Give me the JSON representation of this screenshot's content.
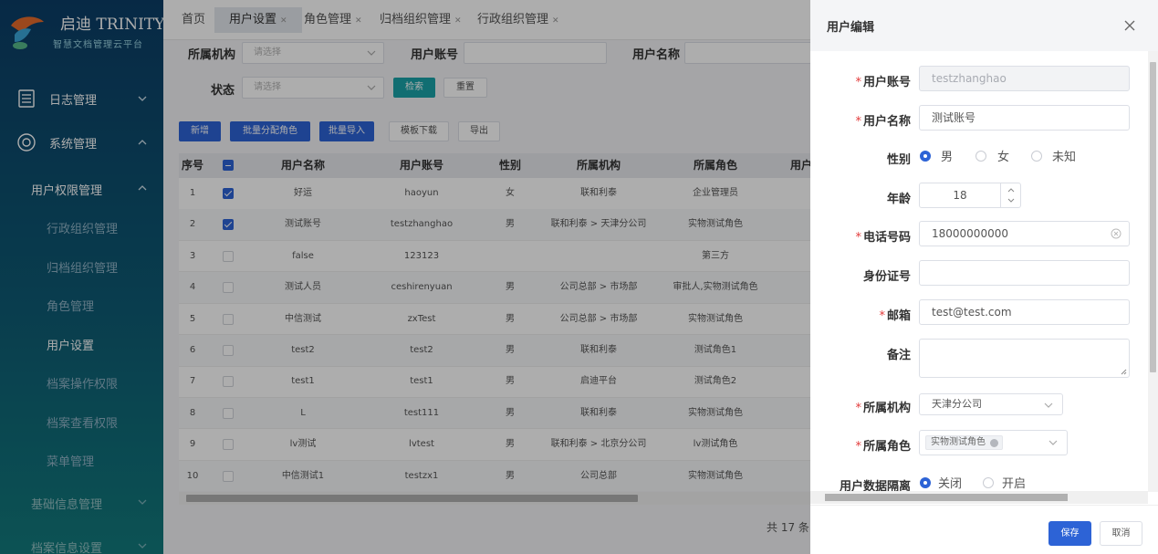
{
  "brand": {
    "name": "启迪 TRINITY",
    "subtitle": "智慧文档管理云平台"
  },
  "sidebar": {
    "items": [
      {
        "label": "日志管理",
        "icon": "list-icon"
      },
      {
        "label": "系统管理",
        "icon": "target-icon"
      }
    ],
    "section_user": "用户权限管理",
    "sub_items": [
      "行政组织管理",
      "归档组织管理",
      "角色管理",
      "用户设置",
      "档案操作权限",
      "档案查看权限",
      "菜单管理"
    ],
    "active_sub": "用户设置",
    "bottom_sections": [
      "基础信息管理",
      "档案信息设置"
    ]
  },
  "tabs": [
    {
      "label": "首页",
      "closable": false
    },
    {
      "label": "用户设置",
      "closable": true
    },
    {
      "label": "角色管理",
      "closable": true
    },
    {
      "label": "归档组织管理",
      "closable": true
    },
    {
      "label": "行政组织管理",
      "closable": true
    }
  ],
  "filters": {
    "org_label": "所属机构",
    "org_placeholder": "请选择",
    "account_label": "用户账号",
    "username_label": "用户名称",
    "status_label": "状态",
    "status_placeholder": "请选择",
    "search_btn": "检索",
    "reset_btn": "重置"
  },
  "toolbar": {
    "add": "新增",
    "assign_roles": "批量分配角色",
    "import": "批量导入",
    "template": "模板下载",
    "export": "导出"
  },
  "table": {
    "columns": [
      "序号",
      "用户名称",
      "用户账号",
      "性别",
      "所属机构",
      "所属角色",
      "用户"
    ],
    "rows": [
      {
        "no": "1",
        "checked": true,
        "name": "好运",
        "account": "haoyun",
        "gender": "女",
        "org": "联和利泰",
        "role": "企业管理员"
      },
      {
        "no": "2",
        "checked": true,
        "name": "测试账号",
        "account": "testzhanghao",
        "gender": "男",
        "org": "联和利泰 > 天津分公司",
        "role": "实物测试角色"
      },
      {
        "no": "3",
        "checked": false,
        "name": "false",
        "account": "123123",
        "gender": "",
        "org": "",
        "role": "第三方"
      },
      {
        "no": "4",
        "checked": false,
        "name": "测试人员",
        "account": "ceshirenyuan",
        "gender": "男",
        "org": "公司总部 > 市场部",
        "role": "审批人,实物测试角色"
      },
      {
        "no": "5",
        "checked": false,
        "name": "中信测试",
        "account": "zxTest",
        "gender": "男",
        "org": "公司总部 > 市场部",
        "role": "实物测试角色"
      },
      {
        "no": "6",
        "checked": false,
        "name": "test2",
        "account": "test2",
        "gender": "男",
        "org": "联和利泰",
        "role": "测试角色1"
      },
      {
        "no": "7",
        "checked": false,
        "name": "test1",
        "account": "test1",
        "gender": "男",
        "org": "启迪平台",
        "role": "测试角色2"
      },
      {
        "no": "8",
        "checked": false,
        "name": "L",
        "account": "test111",
        "gender": "男",
        "org": "联和利泰",
        "role": "实物测试角色"
      },
      {
        "no": "9",
        "checked": false,
        "name": "lv测试",
        "account": "lvtest",
        "gender": "男",
        "org": "联和利泰 > 北京分公司",
        "role": "lv测试角色"
      },
      {
        "no": "10",
        "checked": false,
        "name": "中信测试1",
        "account": "testzx1",
        "gender": "男",
        "org": "公司总部",
        "role": "实物测试角色"
      }
    ],
    "total": "共 17 条"
  },
  "drawer": {
    "title": "用户编辑",
    "fields": {
      "account": {
        "label": "用户账号",
        "value": "testzhanghao"
      },
      "name": {
        "label": "用户名称",
        "value": "测试账号"
      },
      "gender": {
        "label": "性别",
        "options": [
          "男",
          "女",
          "未知"
        ],
        "selected": "男"
      },
      "age": {
        "label": "年龄",
        "value": "18"
      },
      "phone": {
        "label": "电话号码",
        "value": "18000000000"
      },
      "idcard": {
        "label": "身份证号",
        "value": ""
      },
      "email": {
        "label": "邮箱",
        "value": "test@test.com"
      },
      "remark": {
        "label": "备注",
        "value": ""
      },
      "org": {
        "label": "所属机构",
        "value": "天津分公司"
      },
      "role": {
        "label": "所属角色",
        "tag": "实物测试角色"
      },
      "isolation": {
        "label": "用户数据隔离",
        "options": [
          "关闭",
          "开启"
        ],
        "selected": "关闭"
      }
    },
    "save": "保存",
    "cancel": "取消"
  },
  "colors": {
    "primary": "#2d63d6",
    "teal": "#1aa3a8",
    "sidebar": "#0b3d66",
    "required": "#e23b3b"
  }
}
